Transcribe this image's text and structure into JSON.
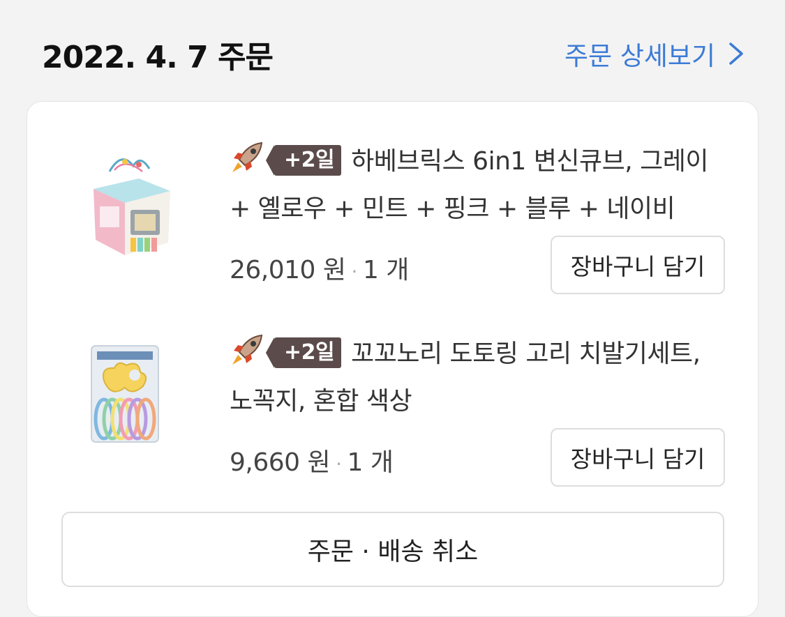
{
  "order": {
    "date_title": "2022. 4. 7 주문",
    "detail_link": "주문 상세보기",
    "cancel_label": "주문 · 배송 취소"
  },
  "items": [
    {
      "badge": "+2일",
      "title_line1": "하베브릭스 6in1 변신큐브, 그레이",
      "title_line2": "+ 옐로우 + 민트 + 핑크 + 블루 + 네이비",
      "price": "26,010 원",
      "quantity": "1 개",
      "cart_label": "장바구니 담기",
      "image_icon": "activity-cube-toy-image"
    },
    {
      "badge": "+2일",
      "title_line1": "꼬꼬노리 도토링 고리 치발기세트,",
      "title_line2": "노꼭지, 혼합 색상",
      "price": "9,660 원",
      "quantity": "1 개",
      "cart_label": "장바구니 담기",
      "image_icon": "teether-ring-set-image"
    }
  ],
  "colors": {
    "link": "#3b7bd6",
    "badge": "#5b4b4b",
    "background": "#f3f3f3"
  }
}
